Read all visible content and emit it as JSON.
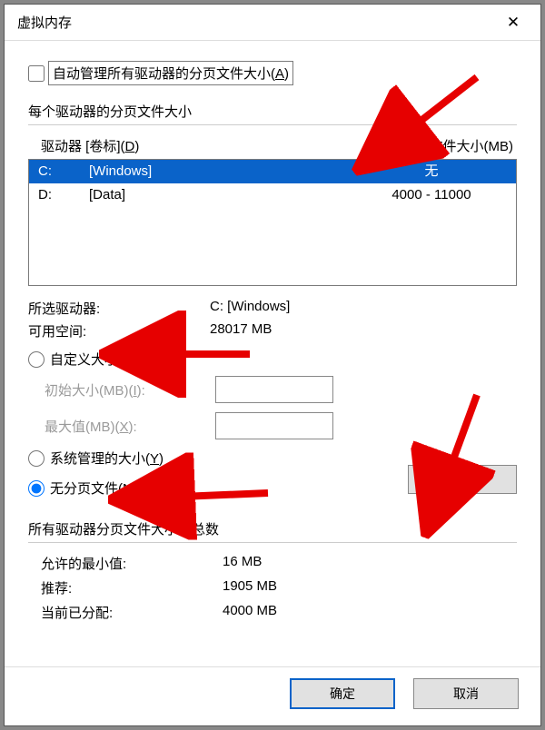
{
  "window": {
    "title": "虚拟内存"
  },
  "auto": {
    "label_pre": "自动管理所有驱动器的分页文件大小(",
    "hotkey": "A",
    "label_post": ")"
  },
  "drives": {
    "caption": "每个驱动器的分页文件大小",
    "header_left_pre": "驱动器 [卷标](",
    "header_left_hot": "D",
    "header_left_post": ")",
    "header_right": "分页文件大小(MB)",
    "rows": [
      {
        "letter": "C:",
        "label": "[Windows]",
        "size": "无",
        "selected": true
      },
      {
        "letter": "D:",
        "label": "[Data]",
        "size": "4000 - 11000",
        "selected": false
      }
    ]
  },
  "selected": {
    "drive_label": "所选驱动器:",
    "drive_value": "C:  [Windows]",
    "free_label": "可用空间:",
    "free_value": "28017 MB"
  },
  "radios": {
    "custom_pre": "自定义大小(",
    "custom_hot": "C",
    "custom_post": "):",
    "system_pre": "系统管理的大小(",
    "system_hot": "Y",
    "system_post": ")",
    "none_pre": "无分页文件(",
    "none_hot": "N",
    "none_post": ")"
  },
  "size": {
    "init_pre": "初始大小(MB)(",
    "init_hot": "I",
    "init_post": "):",
    "max_pre": "最大值(MB)(",
    "max_hot": "X",
    "max_post": "):"
  },
  "set_btn_pre": "设置(",
  "set_btn_hot": "S",
  "set_btn_post": ")",
  "totals": {
    "caption": "所有驱动器分页文件大小的总数",
    "min_label": "允许的最小值:",
    "min_value": "16 MB",
    "rec_label": "推荐:",
    "rec_value": "1905 MB",
    "cur_label": "当前已分配:",
    "cur_value": "4000 MB"
  },
  "footer": {
    "ok": "确定",
    "cancel": "取消"
  }
}
